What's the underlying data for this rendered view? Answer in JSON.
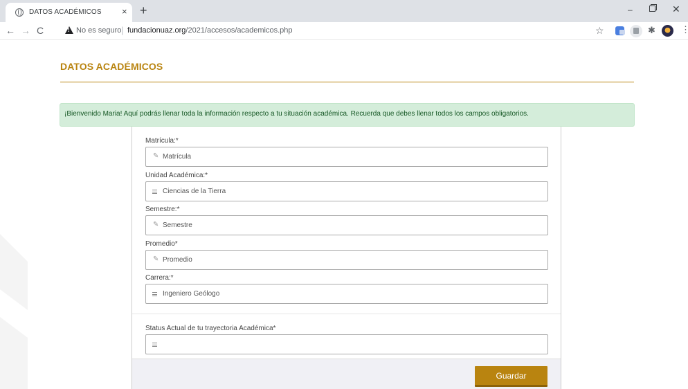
{
  "browser": {
    "tab_title": "DATOS ACADÉMICOS",
    "tab_close": "×",
    "new_tab": "+",
    "window_min": "–",
    "window_close": "✕",
    "nav_back": "←",
    "nav_forward": "→",
    "nav_reload": "C",
    "security_label": "No es seguro",
    "url_host": "fundacionuaz.org",
    "url_path": "/2021/accesos/academicos.php",
    "bookmark_star": "☆",
    "extensions_icon": "✱",
    "menu_icon": "⋮"
  },
  "page": {
    "title": "DATOS ACADÉMICOS",
    "accent_color": "#b98410",
    "alert": "¡Bienvenido Maria! Aquí podrás llenar toda la información respecto a tu situación académica. Recuerda que debes llenar todos los campos obligatorios."
  },
  "form": {
    "fields": [
      {
        "label": "Matrícula:*",
        "value": "Matrícula",
        "icon": "pencil-icon"
      },
      {
        "label": "Unidad Académica:*",
        "value": "Ciencias de la Tierra",
        "icon": "list-icon"
      },
      {
        "label": "Semestre:*",
        "value": "Semestre",
        "icon": "pencil-icon"
      },
      {
        "label": "Promedio*",
        "value": "Promedio",
        "icon": "pencil-icon"
      },
      {
        "label": "Carrera:*",
        "value": "Ingeniero Geólogo",
        "icon": "list-icon"
      },
      {
        "label": "Status Actual de tu trayectoria Académica*",
        "value": "",
        "icon": "list-icon"
      }
    ],
    "pencil_glyph": "✎",
    "save_label": "Guardar"
  }
}
